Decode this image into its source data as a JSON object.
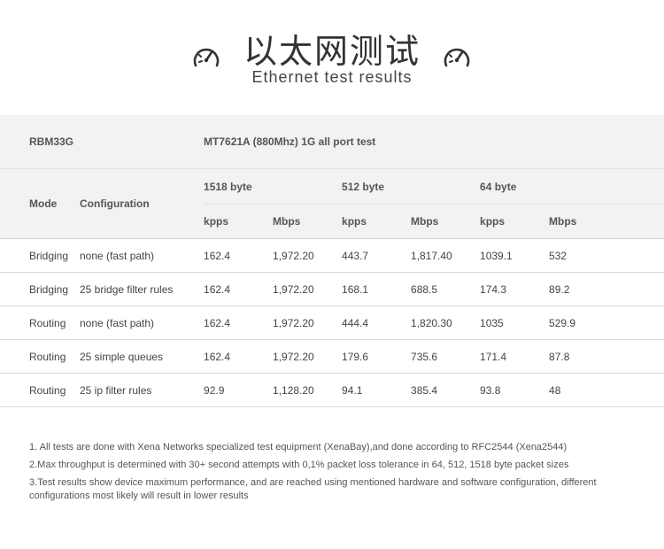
{
  "header": {
    "title_cn": "以太网测试",
    "title_en": "Ethernet test results",
    "icons": [
      "speedometer-icon",
      "speedometer-icon"
    ]
  },
  "table": {
    "model": "RBM33G",
    "test_name": "MT7621A (880Mhz) 1G all port test",
    "col_mode": "Mode",
    "col_config": "Configuration",
    "groups": [
      "1518 byte",
      "512 byte",
      "64 byte"
    ],
    "sub_kpps": "kpps",
    "sub_mbps": "Mbps",
    "rows": [
      {
        "mode": "Bridging",
        "config": "none (fast path)",
        "v": [
          "162.4",
          "1,972.20",
          "443.7",
          "1,817.40",
          "1039.1",
          "532"
        ]
      },
      {
        "mode": "Bridging",
        "config": "25 bridge filter rules",
        "v": [
          "162.4",
          "1,972.20",
          "168.1",
          "688.5",
          "174.3",
          "89.2"
        ]
      },
      {
        "mode": "Routing",
        "config": "none (fast path)",
        "v": [
          "162.4",
          "1,972.20",
          "444.4",
          "1,820.30",
          "1035",
          "529.9"
        ]
      },
      {
        "mode": "Routing",
        "config": "25 simple queues",
        "v": [
          "162.4",
          "1,972.20",
          "179.6",
          "735.6",
          "171.4",
          "87.8"
        ]
      },
      {
        "mode": "Routing",
        "config": "25 ip filter rules",
        "v": [
          "92.9",
          "1,128.20",
          "94.1",
          "385.4",
          "93.8",
          "48"
        ]
      }
    ]
  },
  "notes": [
    "1. All tests are done with Xena Networks specialized test equipment (XenaBay),and done according to RFC2544 (Xena2544)",
    "2.Max throughput is determined with 30+ second attempts with 0,1% packet loss tolerance in 64, 512, 1518 byte packet sizes",
    "3.Test results show device maximum performance, and are reached using mentioned hardware and software configuration, different configurations most likely will result in lower results"
  ]
}
